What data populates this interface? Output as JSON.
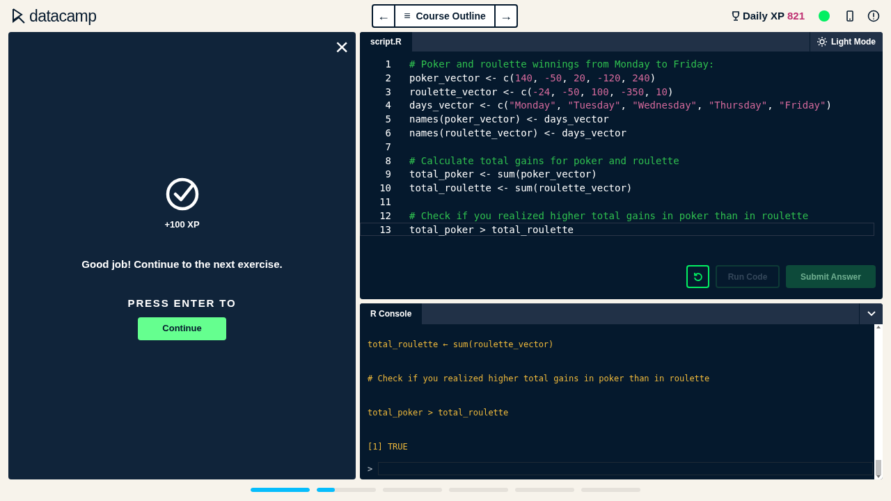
{
  "header": {
    "logo": "datacamp",
    "nav": {
      "prev": "←",
      "outline_icon": "≡",
      "outline": "Course Outline",
      "next": "→"
    },
    "xp_label": "Daily XP",
    "xp_value": "821",
    "online": true
  },
  "modal": {
    "close": "×",
    "xp": "+100 XP",
    "message": "Good job! Continue to the next exercise.",
    "prompt": "PRESS ENTER TO",
    "button": "Continue"
  },
  "editor": {
    "tab": "script.R",
    "mode_button": "Light Mode",
    "lines": [
      {
        "number": "1",
        "current": false,
        "tokens": [
          {
            "text": "# Poker and roulette winnings from Monday to Friday:",
            "kind": "comment"
          }
        ]
      },
      {
        "number": "2",
        "current": false,
        "tokens": [
          {
            "text": "poker_vector <- c(",
            "kind": "plain"
          },
          {
            "text": "140",
            "kind": "number"
          },
          {
            "text": ", ",
            "kind": "plain"
          },
          {
            "text": "-50",
            "kind": "number"
          },
          {
            "text": ", ",
            "kind": "plain"
          },
          {
            "text": "20",
            "kind": "number"
          },
          {
            "text": ", ",
            "kind": "plain"
          },
          {
            "text": "-120",
            "kind": "number"
          },
          {
            "text": ", ",
            "kind": "plain"
          },
          {
            "text": "240",
            "kind": "number"
          },
          {
            "text": ")",
            "kind": "plain"
          }
        ]
      },
      {
        "number": "3",
        "current": false,
        "tokens": [
          {
            "text": "roulette_vector <- c(",
            "kind": "plain"
          },
          {
            "text": "-24",
            "kind": "number"
          },
          {
            "text": ", ",
            "kind": "plain"
          },
          {
            "text": "-50",
            "kind": "number"
          },
          {
            "text": ", ",
            "kind": "plain"
          },
          {
            "text": "100",
            "kind": "number"
          },
          {
            "text": ", ",
            "kind": "plain"
          },
          {
            "text": "-350",
            "kind": "number"
          },
          {
            "text": ", ",
            "kind": "plain"
          },
          {
            "text": "10",
            "kind": "number"
          },
          {
            "text": ")",
            "kind": "plain"
          }
        ]
      },
      {
        "number": "4",
        "current": false,
        "tokens": [
          {
            "text": "days_vector <- c(",
            "kind": "plain"
          },
          {
            "text": "\"Monday\"",
            "kind": "string"
          },
          {
            "text": ", ",
            "kind": "plain"
          },
          {
            "text": "\"Tuesday\"",
            "kind": "string"
          },
          {
            "text": ", ",
            "kind": "plain"
          },
          {
            "text": "\"Wednesday\"",
            "kind": "string"
          },
          {
            "text": ", ",
            "kind": "plain"
          },
          {
            "text": "\"Thursday\"",
            "kind": "string"
          },
          {
            "text": ", ",
            "kind": "plain"
          },
          {
            "text": "\"Friday\"",
            "kind": "string"
          },
          {
            "text": ")",
            "kind": "plain"
          }
        ]
      },
      {
        "number": "5",
        "current": false,
        "tokens": [
          {
            "text": "names(poker_vector) <- days_vector",
            "kind": "plain"
          }
        ]
      },
      {
        "number": "6",
        "current": false,
        "tokens": [
          {
            "text": "names(roulette_vector) <- days_vector",
            "kind": "plain"
          }
        ]
      },
      {
        "number": "7",
        "current": false
      },
      {
        "number": "8",
        "current": false,
        "tokens": [
          {
            "text": "# Calculate total gains for poker and roulette",
            "kind": "comment"
          }
        ]
      },
      {
        "number": "9",
        "current": false,
        "tokens": [
          {
            "text": "total_poker <- sum(poker_vector)",
            "kind": "plain"
          }
        ]
      },
      {
        "number": "10",
        "current": false,
        "tokens": [
          {
            "text": "total_roulette <- sum(roulette_vector)",
            "kind": "plain"
          }
        ]
      },
      {
        "number": "11",
        "current": false
      },
      {
        "number": "12",
        "current": false,
        "tokens": [
          {
            "text": "# Check if you realized higher total gains in poker than in roulette",
            "kind": "comment"
          }
        ]
      },
      {
        "number": "13",
        "current": true,
        "tokens": [
          {
            "text": "total_poker > total_roulette",
            "kind": "plain"
          }
        ]
      }
    ],
    "buttons": [
      {
        "kind": "reset",
        "disabled": false
      },
      {
        "kind": "run",
        "label": "Run Code",
        "disabled": true
      },
      {
        "kind": "submit",
        "label": "Submit Answer",
        "disabled": true
      }
    ]
  },
  "console": {
    "tab": "R Console",
    "lines": [
      "total_roulette ← sum(roulette_vector)",
      "# Check if you realized higher total gains in poker than in roulette",
      "total_poker > total_roulette",
      "[1] TRUE"
    ],
    "prompt": ">"
  },
  "progress": [
    {
      "level": 1
    },
    {
      "level": 0.3
    },
    {
      "level": 0
    },
    {
      "level": 0
    },
    {
      "level": 0
    },
    {
      "level": 0
    }
  ]
}
